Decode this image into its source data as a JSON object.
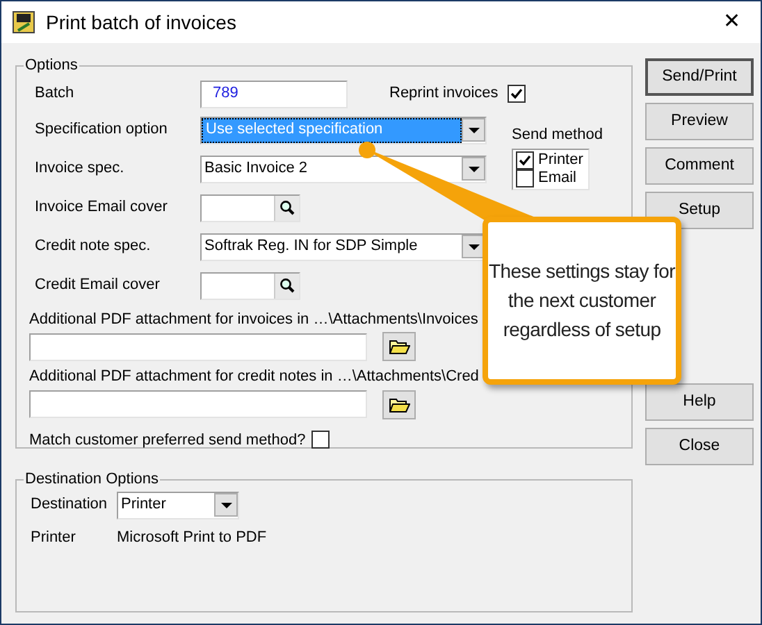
{
  "window": {
    "title": "Print batch of invoices",
    "close": "✕"
  },
  "options": {
    "title": "Options",
    "batch": {
      "label": "Batch",
      "value": "789"
    },
    "reprint": {
      "label": "Reprint invoices",
      "checked": true
    },
    "rows": [
      {
        "kind": "combo",
        "label": "Specification option",
        "value": "Use selected specification",
        "selected": true
      },
      {
        "kind": "combo",
        "label": "Invoice spec.",
        "value": "Basic Invoice 2",
        "selected": false
      },
      {
        "kind": "lookup",
        "label": "Invoice Email cover"
      },
      {
        "kind": "combo",
        "label": "Credit note spec.",
        "value": "Softrak Reg. IN for SDP Simple",
        "selected": false
      },
      {
        "kind": "lookup",
        "label": "Credit Email cover"
      }
    ],
    "send_method": {
      "label": "Send method",
      "options": [
        {
          "label": "Printer",
          "checked": true
        },
        {
          "label": "Email",
          "checked": false
        }
      ]
    },
    "attachments": [
      {
        "label": "Additional PDF attachment for invoices in …\\Attachments\\Invoices"
      },
      {
        "label": "Additional PDF attachment for credit notes in …\\Attachments\\Cred"
      }
    ],
    "match": {
      "label": "Match customer preferred send method?",
      "checked": false
    }
  },
  "destination": {
    "title": "Destination Options",
    "destination": {
      "label": "Destination",
      "value": "Printer"
    },
    "printer": {
      "label": "Printer",
      "value": "Microsoft Print to PDF"
    }
  },
  "buttons_top": [
    {
      "label": "Send/Print",
      "default": true
    },
    {
      "label": "Preview",
      "default": false
    },
    {
      "label": "Comment",
      "default": false
    },
    {
      "label": "Setup",
      "default": false
    }
  ],
  "buttons_bottom": [
    {
      "label": "Help",
      "default": false
    },
    {
      "label": "Close",
      "default": false
    }
  ],
  "callout": {
    "text": "These settings stay for the next customer regardless of setup"
  }
}
